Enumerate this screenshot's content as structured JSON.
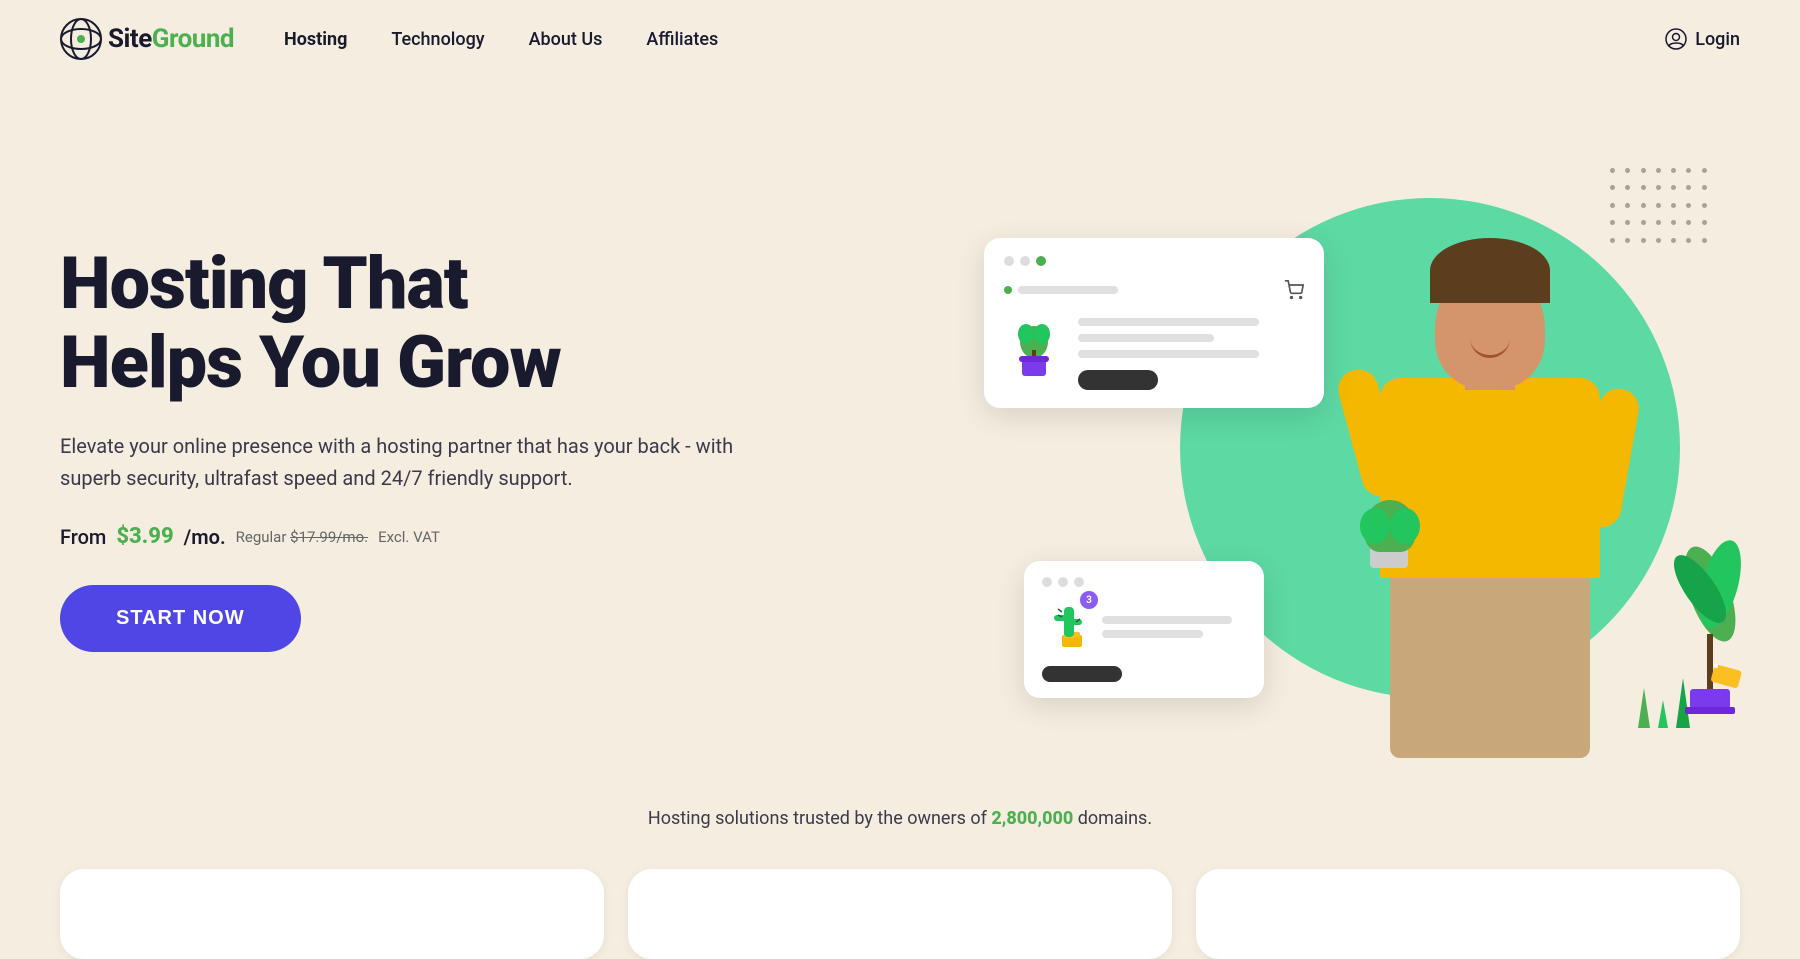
{
  "logo": {
    "text": "SiteGround",
    "icon_alt": "siteground-logo"
  },
  "nav": {
    "links": [
      {
        "label": "Hosting",
        "bold": true
      },
      {
        "label": "Technology",
        "bold": false
      },
      {
        "label": "About Us",
        "bold": false
      },
      {
        "label": "Affiliates",
        "bold": false
      }
    ],
    "login_label": "Login"
  },
  "hero": {
    "title_line1": "Hosting That",
    "title_line2": "Helps You Grow",
    "description": "Elevate your online presence with a hosting partner that has your back - with superb security, ultrafast speed and 24/7 friendly support.",
    "pricing_from": "From",
    "pricing_price": "$3.99",
    "pricing_mo": "/mo.",
    "pricing_regular_label": "Regular",
    "pricing_regular_strikethrough": "$17.99/mo.",
    "pricing_excl_vat": "Excl. VAT",
    "cta_button": "START NOW"
  },
  "trust": {
    "text_before": "Hosting solutions trusted by the owners of",
    "highlight": "2,800,000",
    "text_after": "domains."
  },
  "colors": {
    "background": "#f5ede0",
    "green_accent": "#5dd9a4",
    "green_text": "#4caf50",
    "cta_button": "#4f46e5",
    "dark_text": "#1a1a2e"
  }
}
